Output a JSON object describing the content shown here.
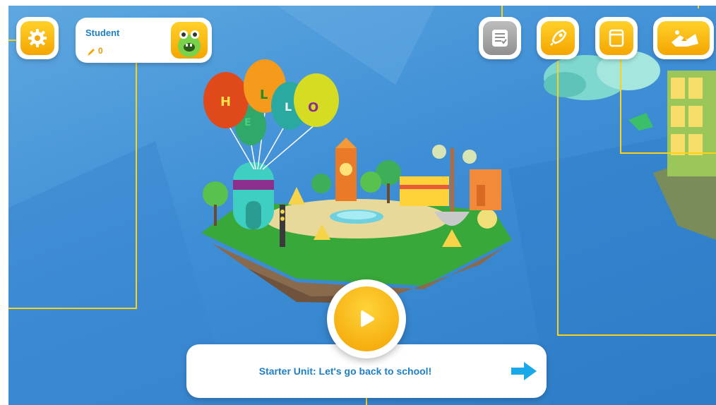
{
  "profile": {
    "name": "Student",
    "points": "0"
  },
  "unit": {
    "title": "Starter Unit: Let's go back to school!"
  },
  "balloons": {
    "letters": [
      "H",
      "E",
      "L",
      "L",
      "O"
    ]
  },
  "toolbar": {
    "settings_icon": "gear-icon",
    "checklist_icon": "checklist-icon",
    "rocket_icon": "rocket-icon",
    "book_icon": "book-icon",
    "map_icon": "map-icon"
  },
  "colors": {
    "accent": "#ffd21a",
    "orange": "#f5a500",
    "blue_text": "#1d7fc4",
    "background": "#3f8fd6",
    "arrow": "#1aa9e8"
  }
}
